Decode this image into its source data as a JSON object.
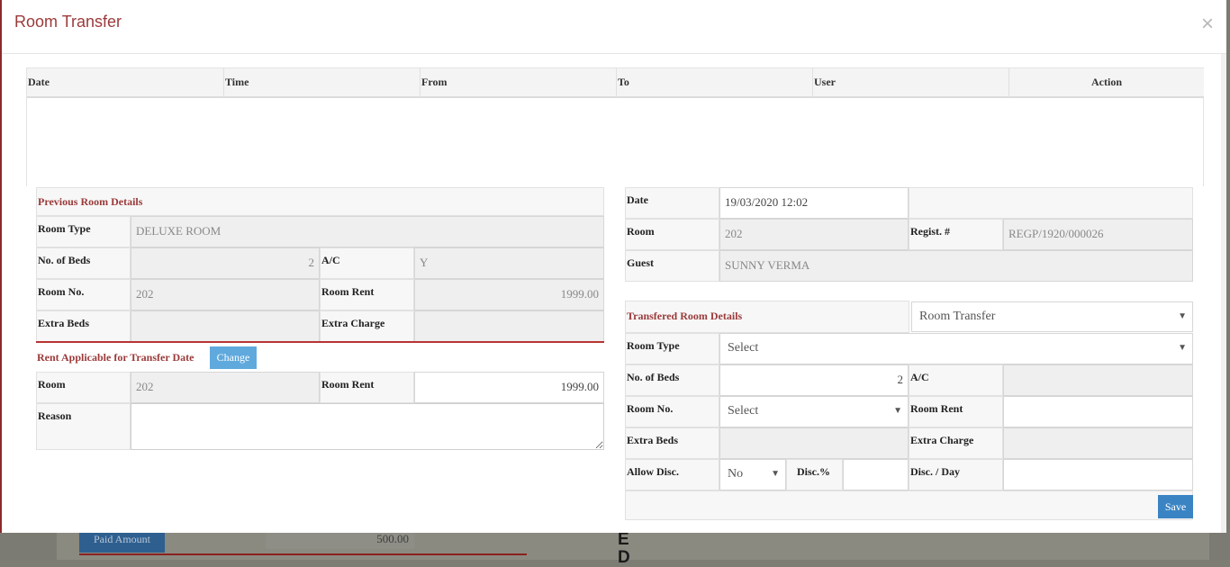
{
  "modal": {
    "title": "Room Transfer",
    "close_symbol": "×"
  },
  "history": {
    "columns": [
      "Date",
      "Time",
      "From",
      "To",
      "User",
      "Action"
    ]
  },
  "previous": {
    "section_title": "Previous Room Details",
    "room_type_label": "Room Type",
    "room_type_value": "DELUXE ROOM",
    "beds_label": "No. of Beds",
    "beds_value": "2",
    "ac_label": "A/C",
    "ac_value": "Y",
    "room_no_label": "Room No.",
    "room_no_value": "202",
    "room_rent_label": "Room Rent",
    "room_rent_value": "1999.00",
    "extra_beds_label": "Extra Beds",
    "extra_beds_value": "",
    "extra_charge_label": "Extra Charge",
    "extra_charge_value": ""
  },
  "rent_applicable": {
    "title": "Rent Applicable for Transfer Date",
    "change_label": "Change",
    "room_label": "Room",
    "room_value": "202",
    "rent_label": "Room Rent",
    "rent_value": "1999.00",
    "reason_label": "Reason",
    "reason_value": ""
  },
  "info": {
    "date_label": "Date",
    "date_value": "19/03/2020 12:02",
    "room_label": "Room",
    "room_value": "202",
    "regist_label": "Regist. #",
    "regist_value": "REGP/1920/000026",
    "guest_label": "Guest",
    "guest_value": "SUNNY VERMA"
  },
  "transferred": {
    "section_title": "Transfered Room Details",
    "mode_value": "Room Transfer",
    "room_type_label": "Room Type",
    "room_type_value": "Select",
    "beds_label": "No. of Beds",
    "beds_value": "2",
    "ac_label": "A/C",
    "ac_value": "",
    "room_no_label": "Room No.",
    "room_no_value": "Select",
    "room_rent_label": "Room Rent",
    "room_rent_value": "",
    "extra_beds_label": "Extra Beds",
    "extra_beds_value": "",
    "extra_charge_label": "Extra Charge",
    "extra_charge_value": "",
    "allow_disc_label": "Allow Disc.",
    "allow_disc_value": "No",
    "disc_pct_label": "Disc.%",
    "disc_pct_value": "",
    "disc_day_label": "Disc. / Day",
    "disc_day_value": "",
    "save_label": "Save"
  },
  "background": {
    "paid_amount_label": "Paid Amount",
    "paid_amount_value": "500.00",
    "letter_1": "E",
    "letter_2": "D"
  }
}
